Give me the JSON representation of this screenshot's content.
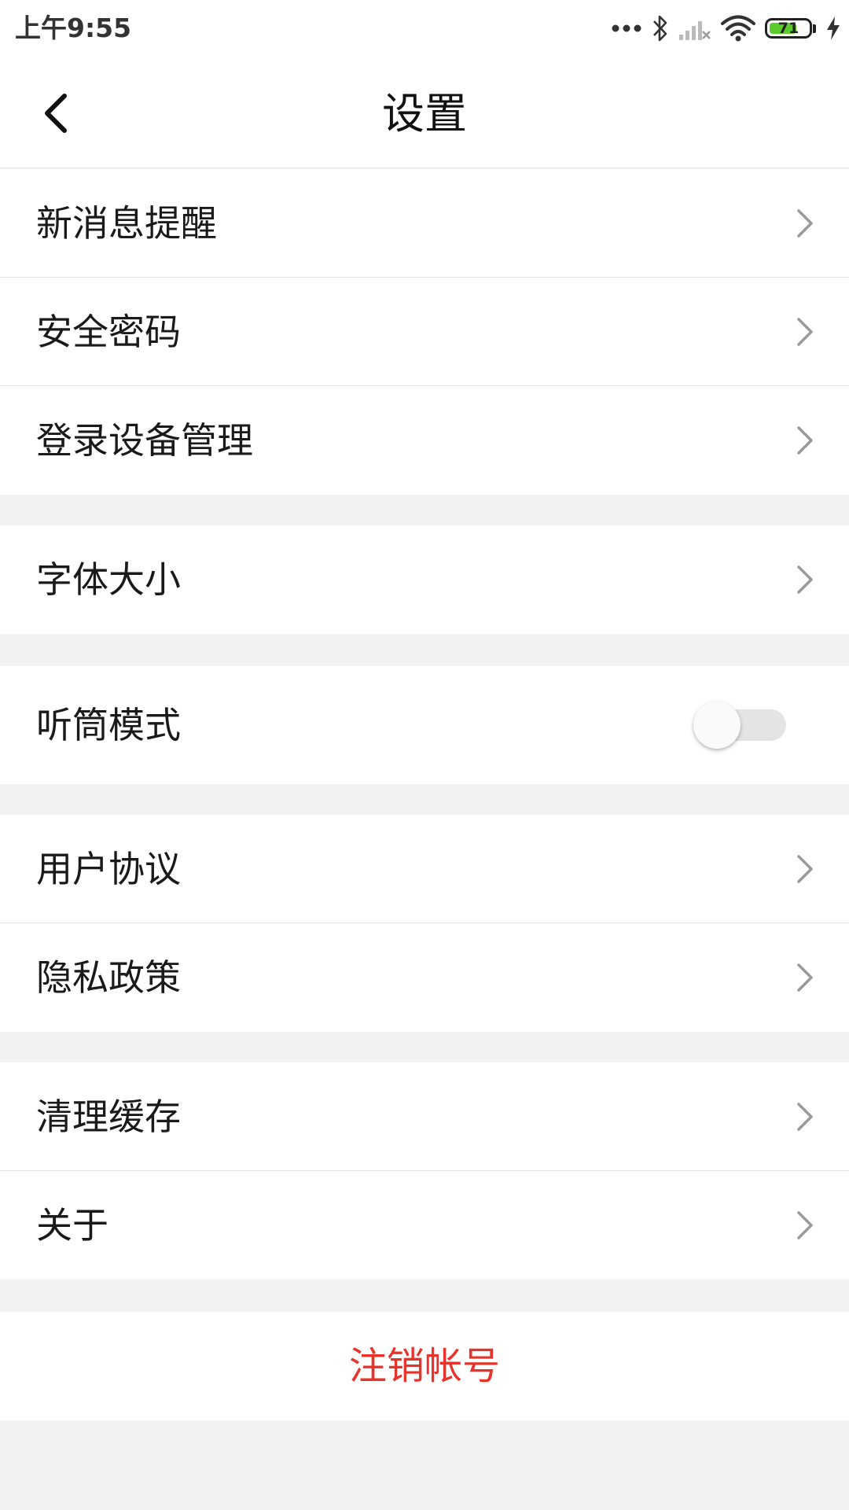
{
  "status_bar": {
    "time": "上午9:55",
    "battery_level": "71",
    "battery_fraction": 0.71,
    "icons": [
      "more-dots-icon",
      "bluetooth-icon",
      "cellular-signal-icon",
      "wifi-icon",
      "battery-icon",
      "charging-icon"
    ]
  },
  "nav": {
    "title": "设置",
    "back_icon": "chevron-left-icon"
  },
  "groups": {
    "account": {
      "items": [
        {
          "label": "新消息提醒"
        },
        {
          "label": "安全密码"
        },
        {
          "label": "登录设备管理"
        }
      ]
    },
    "display": {
      "items": [
        {
          "label": "字体大小"
        }
      ]
    },
    "earpiece": {
      "label": "听筒模式",
      "enabled": false
    },
    "legal": {
      "items": [
        {
          "label": "用户协议"
        },
        {
          "label": "隐私政策"
        }
      ]
    },
    "misc": {
      "items": [
        {
          "label": "清理缓存"
        },
        {
          "label": "关于"
        }
      ]
    }
  },
  "logout_label": "注销帐号",
  "colors": {
    "accent_red": "#e8332a",
    "background": "#f2f2f2",
    "battery_green": "#5ccb2e"
  }
}
